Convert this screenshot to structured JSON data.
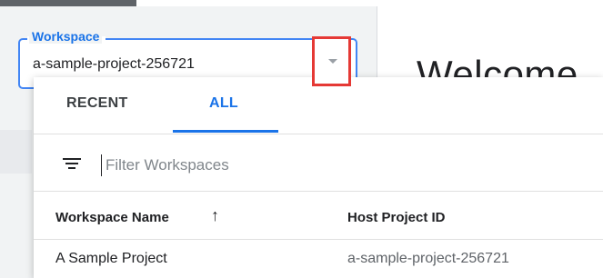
{
  "page": {
    "welcome_text": "Welcome"
  },
  "workspace_selector": {
    "label": "Workspace",
    "value": "a-sample-project-256721"
  },
  "dropdown": {
    "tabs": [
      {
        "label": "RECENT",
        "active": false
      },
      {
        "label": "ALL",
        "active": true
      }
    ],
    "filter": {
      "placeholder": "Filter Workspaces",
      "value": ""
    },
    "table": {
      "columns": [
        "Workspace Name",
        "Host Project ID"
      ],
      "sort_icon": "arrow-up-icon",
      "rows": [
        {
          "name": "A Sample Project",
          "host_project_id": "a-sample-project-256721"
        }
      ]
    }
  },
  "colors": {
    "accent": "#1a73e8",
    "highlight": "#e53935"
  }
}
